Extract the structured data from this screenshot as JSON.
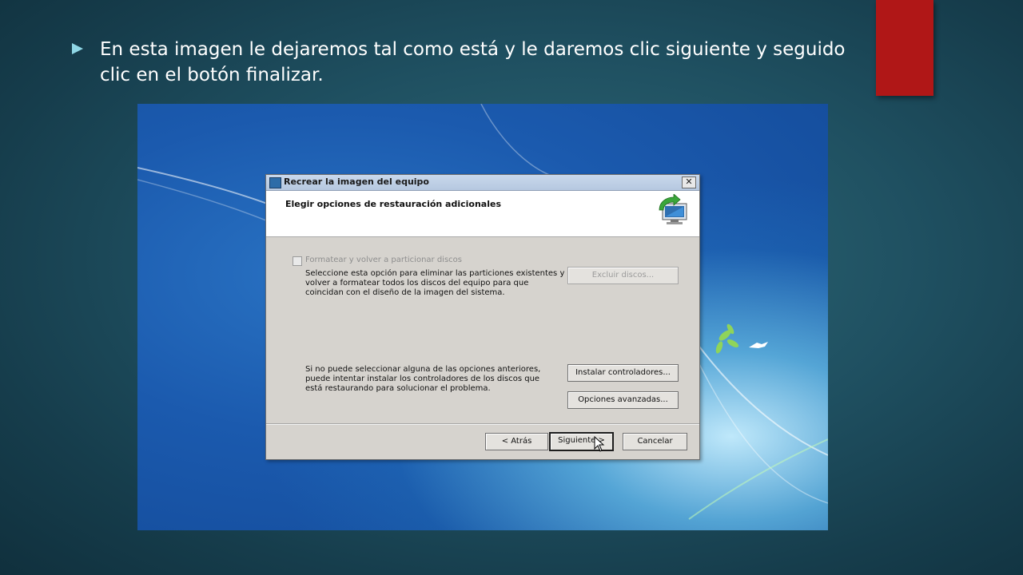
{
  "slide": {
    "bullet_text": "En esta imagen le dejaremos tal como está y le daremos clic siguiente y seguido clic en el botón finalizar."
  },
  "dialog": {
    "title": "Recrear la imagen del equipo",
    "close_symbol": "✕",
    "header_title": "Elegir opciones de restauración adicionales",
    "format_checkbox": {
      "label": "Formatear y volver a particionar discos",
      "checked": false,
      "enabled": false
    },
    "format_description": "Seleccione esta opción para eliminar las particiones existentes y volver a formatear todos los discos del equipo para que coincidan con el diseño de la imagen del sistema.",
    "exclude_disks_label": "Excluir discos...",
    "drivers_description": "Si no puede seleccionar alguna de las opciones anteriores, puede intentar instalar los controladores de los discos que está restaurando para solucionar el problema.",
    "install_drivers_label": "Instalar controladores...",
    "advanced_options_label": "Opciones avanzadas...",
    "back_label": "< Atrás",
    "next_label": "Siguiente >",
    "cancel_label": "Cancelar"
  },
  "colors": {
    "accent_red": "#b01717",
    "bullet": "#8fd7e6",
    "desktop_blue": "#1b5aae"
  },
  "icons": {
    "bullet": "triangle-bullet-icon",
    "app": "system-image-icon",
    "header": "computer-restore-icon",
    "close": "close-icon",
    "cursor": "mouse-pointer-icon"
  }
}
